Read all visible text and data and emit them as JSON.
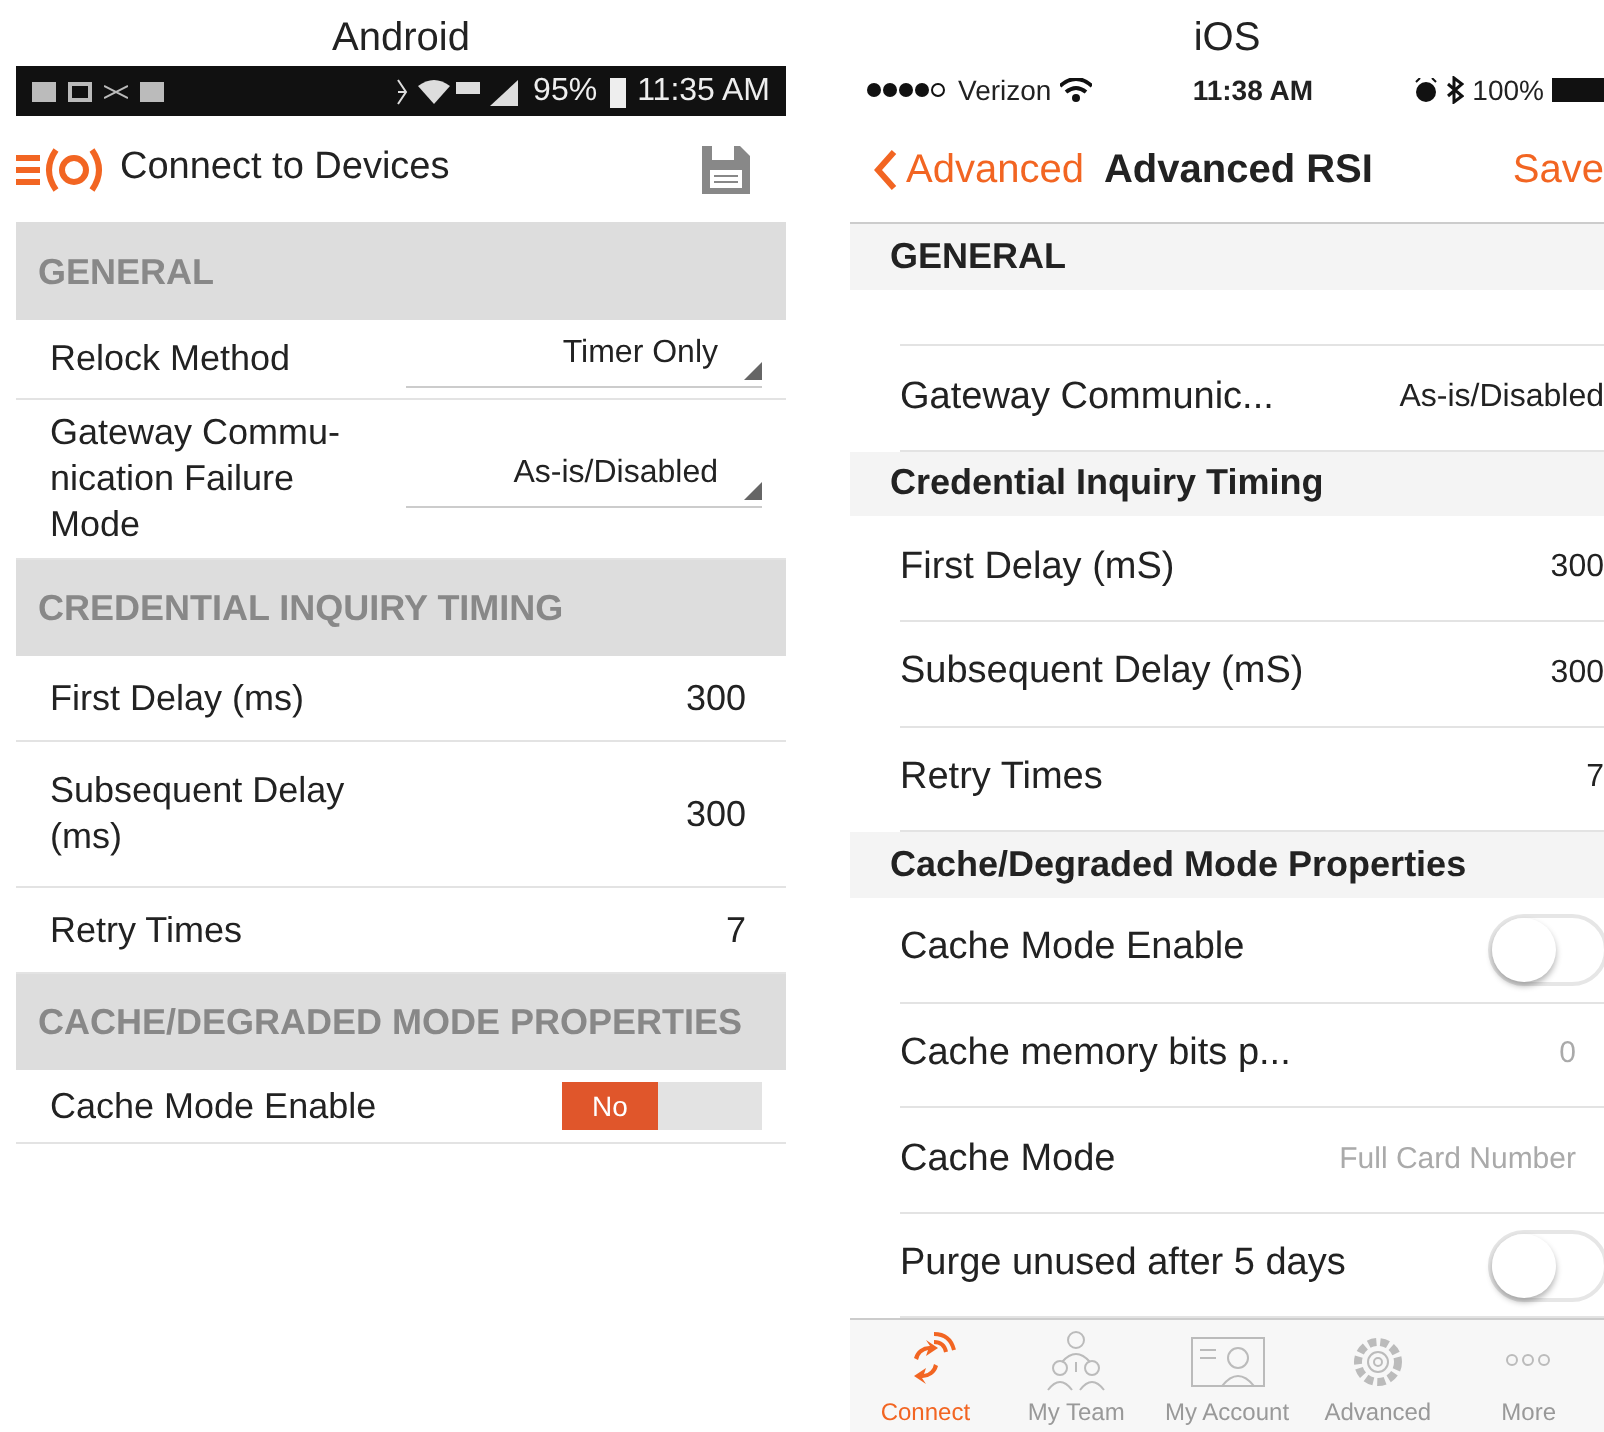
{
  "android": {
    "caption": "Android",
    "status_bar": {
      "battery": "95%",
      "time": "11:35 AM"
    },
    "app_bar": {
      "title": "Connect to Devices"
    },
    "sections": [
      {
        "title": "GENERAL",
        "rows": [
          {
            "kind": "dropdown",
            "label": "Relock Method",
            "value": "Timer Only"
          },
          {
            "kind": "dropdown",
            "label": "Gateway Commu-nication Failure Mode",
            "value": "As-is/Disabled"
          }
        ]
      },
      {
        "title": "CREDENTIAL INQUIRY TIMING",
        "rows": [
          {
            "kind": "text",
            "label": "First Delay (ms)",
            "value": "300"
          },
          {
            "kind": "text",
            "label": "Subsequent Delay (ms)",
            "value": "300"
          },
          {
            "kind": "text",
            "label": "Retry Times",
            "value": "7"
          }
        ]
      },
      {
        "title": "CACHE/DEGRADED MODE PROPERTIES",
        "rows": [
          {
            "kind": "toggle",
            "label": "Cache Mode Enable",
            "value": "No",
            "on": false
          }
        ]
      }
    ]
  },
  "ios": {
    "caption": "iOS",
    "status_bar": {
      "carrier": "Verizon",
      "time": "11:38 AM",
      "battery": "100%"
    },
    "nav_bar": {
      "back": "Advanced",
      "title": "Advanced RSI",
      "action": "Save"
    },
    "sections": [
      {
        "title": "GENERAL",
        "rows": [
          {
            "kind": "text",
            "label": "Gateway Communic...",
            "value": "As-is/Disabled"
          }
        ]
      },
      {
        "title": "Credential Inquiry Timing",
        "rows": [
          {
            "kind": "text",
            "label": "First Delay (mS)",
            "value": "300"
          },
          {
            "kind": "text",
            "label": "Subsequent Delay (mS)",
            "value": "300"
          },
          {
            "kind": "text",
            "label": "Retry Times",
            "value": "7"
          }
        ]
      },
      {
        "title": "Cache/Degraded Mode Properties",
        "rows": [
          {
            "kind": "switch",
            "label": "Cache Mode Enable",
            "on": false
          },
          {
            "kind": "hint",
            "label": "Cache memory bits p...",
            "value": "0"
          },
          {
            "kind": "hint",
            "label": "Cache Mode",
            "value": "Full Card Number"
          },
          {
            "kind": "switch",
            "label": "Purge unused after 5 days",
            "on": false
          }
        ]
      }
    ],
    "tab_bar": [
      {
        "label": "Connect",
        "selected": true
      },
      {
        "label": "My Team",
        "selected": false
      },
      {
        "label": "My Account",
        "selected": false
      },
      {
        "label": "Advanced",
        "selected": false
      },
      {
        "label": "More",
        "selected": false
      }
    ]
  }
}
